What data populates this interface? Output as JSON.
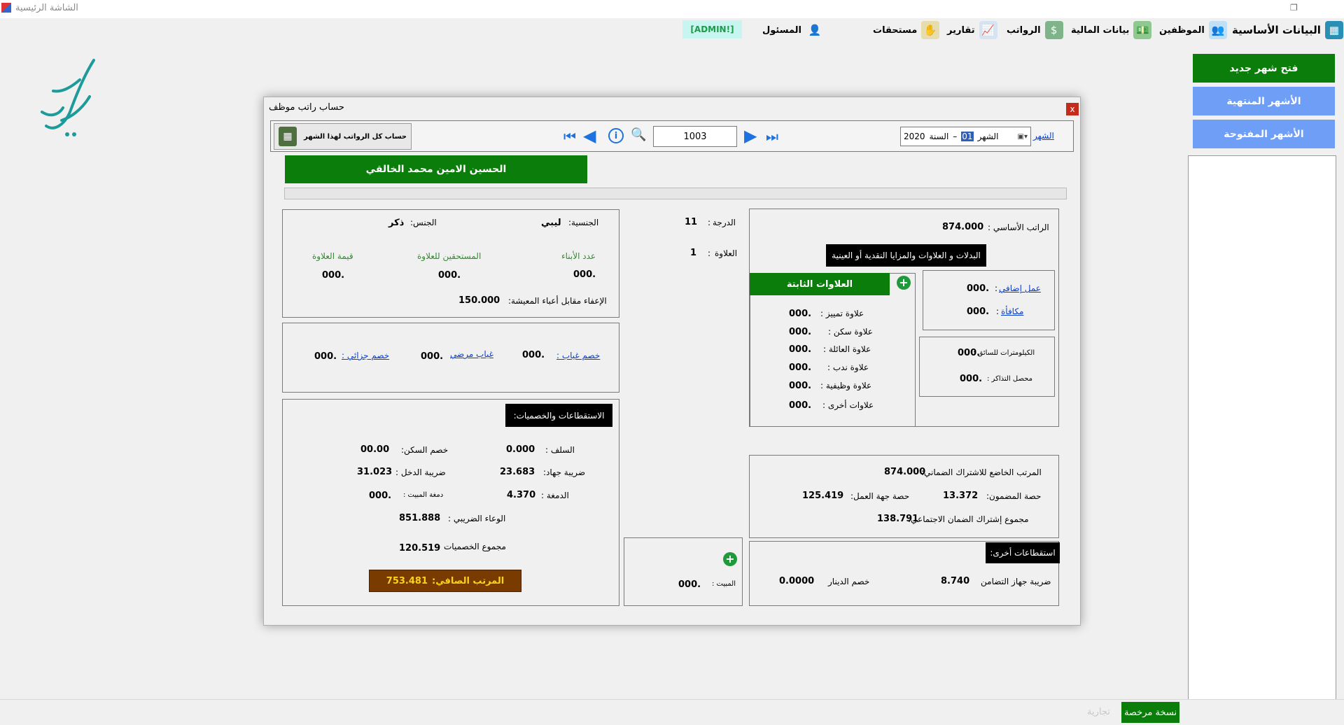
{
  "window": {
    "title": "الشاشة الرئيسية"
  },
  "menu": {
    "basic_data": "البيانات الأساسية",
    "employees": "الموظفين",
    "financial_data": "بيانات المالية",
    "salaries": "الرواتب",
    "reports": "تقارير",
    "dues": "مستحقات",
    "responsible": "المسئول",
    "admin_badge": "[ADMIN!]"
  },
  "sidebar": {
    "open_month": "فتح شهر جديد",
    "closed_months": "الأشهر المنتهية",
    "open_months": "الأشهر المفتوحة"
  },
  "status": {
    "license": "نسخة مرخصة",
    "license_faded": "تجارية"
  },
  "dialog": {
    "title": "حساب راتب موظف",
    "close": "x",
    "toolbar": {
      "calc_all": "حساب كل الرواتب لهذا الشهر",
      "employee_no": "1003",
      "month_link": "الشهر",
      "month_label": "الشهر",
      "month_value": "01",
      "year_label": "السنة",
      "year_value": "2020"
    },
    "employee_name": "الحسين الامين محمد الخالقي",
    "grade_label": "الدرجة",
    "grade_value": "11",
    "allowance_label": "العلاوة",
    "allowance_value": "1",
    "personal": {
      "nationality_label": "الجنسية:",
      "nationality_value": "ليبي",
      "gender_label": "الجنس:",
      "gender_value": "ذكر",
      "children_label": "عدد الأبناء",
      "children_value": "000.",
      "eligible_label": "المستحقين للعلاوة",
      "eligible_value": "000.",
      "allowance_amount_label": "قيمة العلاوة",
      "allowance_amount_value": "000.",
      "exemption_label": "الإعفاء مقابل أعباء المعيشة:",
      "exemption_value": "150.000"
    },
    "absence": {
      "absence_label": "خصم غياب :",
      "absence_value": "000.",
      "sick_label": "غياب مرضي",
      "sick_value": "000.",
      "partial_label": "خصم جزائي :",
      "partial_value": "000."
    },
    "deductions": {
      "header": "الاستقطاعات والخصميات:",
      "loans_label": "السلف :",
      "loans_value": "0.000",
      "housing_label": "خصم السكن:",
      "housing_value": "00.00",
      "jihad_label": "ضريبة جهاد:",
      "jihad_value": "23.683",
      "income_label": "ضريبة الدخل :",
      "income_value": "31.023",
      "stamp_label": "الدمغة :",
      "stamp_value": "4.370",
      "overnight_label": "دمغة المبيت :",
      "overnight_value": "000.",
      "tax_base_label": "الوعاء الضريبي :",
      "tax_base_value": "851.888",
      "total_label": "مجموع الخصميات",
      "total_value": "120.519",
      "net_label": "المرتب الصافي:",
      "net_value": "753.481"
    },
    "overnight": {
      "label": "المبيت :",
      "value": "000."
    },
    "basic_salary_label": "الراتب الأساسي :",
    "basic_salary_value": "874.000",
    "benefits_header": "البدلات و العلاوات والمزايا النقدية أو العينية",
    "fixed_allowances": {
      "header": "العلاوات الثابتة",
      "items": [
        {
          "label": "علاوة تمييز :",
          "value": "000."
        },
        {
          "label": "علاوة سكن :",
          "value": "000."
        },
        {
          "label": "علاوة العائلة :",
          "value": "000."
        },
        {
          "label": "علاوة ندب :",
          "value": "000."
        },
        {
          "label": "علاوة وظيفية :",
          "value": "000."
        },
        {
          "label": "علاوات أخرى :",
          "value": "000."
        }
      ]
    },
    "extra": {
      "overtime_label": "عمل إضافي",
      "overtime_value": "000.",
      "bonus_label": "مكافأة",
      "bonus_value": "000.",
      "km_label": "الكيلومترات للسائق :",
      "km_value": "000.",
      "tickets_label": "محصل التذاكر :",
      "tickets_value": "000."
    },
    "social": {
      "subject_label": "المرتب الخاضع للاشتراك الضماني:",
      "subject_value": "874.000",
      "insured_label": "حصة المضمون:",
      "insured_value": "13.372",
      "employer_label": "حصة جهة العمل:",
      "employer_value": "125.419",
      "total_label": "مجموع إشتراك الضمان الاجتماعي:",
      "total_value": "138.791"
    },
    "other_deductions": {
      "header": "استقطاعات أخرى:",
      "solidarity_label": "ضريبة جهاز التضامن",
      "solidarity_value": "8.740",
      "dinar_label": "خصم الدينار",
      "dinar_value": "0.0000"
    }
  }
}
